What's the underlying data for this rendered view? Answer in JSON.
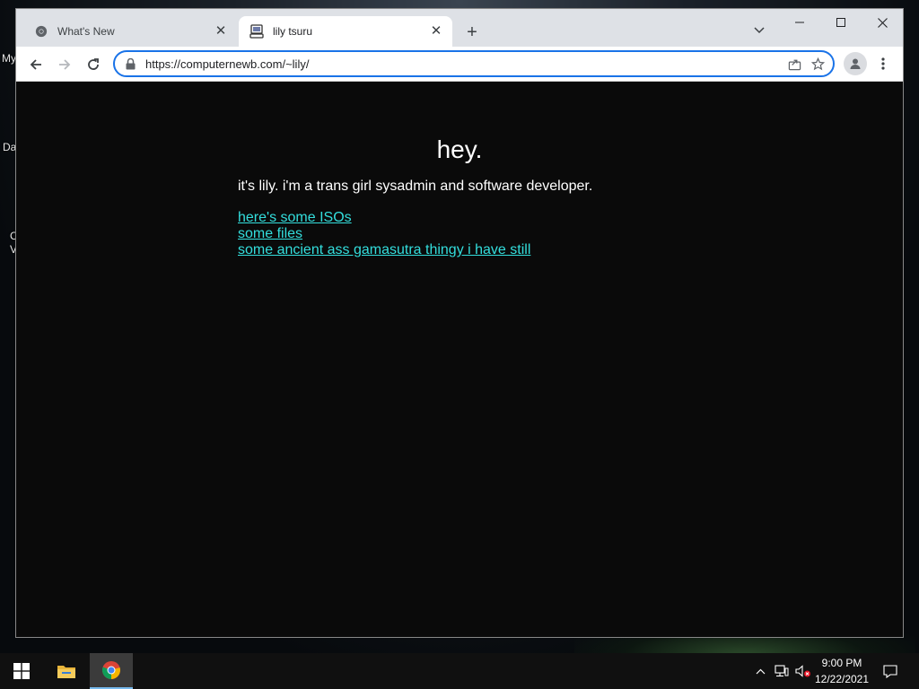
{
  "browser": {
    "tabs": [
      {
        "title": "What's New",
        "icon": "chrome-icon",
        "active": false
      },
      {
        "title": "lily tsuru",
        "icon": "site-favicon",
        "active": true
      }
    ],
    "address_bar": {
      "value": "https://computernewb.com/~lily/"
    },
    "accent_color": "#1a73e8"
  },
  "page": {
    "heading": "hey.",
    "intro": "it's lily. i'm a trans girl sysadmin and software developer.",
    "links": [
      "here's some ISOs",
      "some files",
      "some ancient ass gamasutra thingy i have still"
    ],
    "background_color": "#0a0a0a",
    "text_color": "#ffffff",
    "link_color": "#33dedd"
  },
  "desktop": {
    "icon_label_fragments": [
      "My",
      "Da",
      "C",
      "V"
    ]
  },
  "taskbar": {
    "clock_time": "9:00 PM",
    "clock_date": "12/22/2021"
  }
}
